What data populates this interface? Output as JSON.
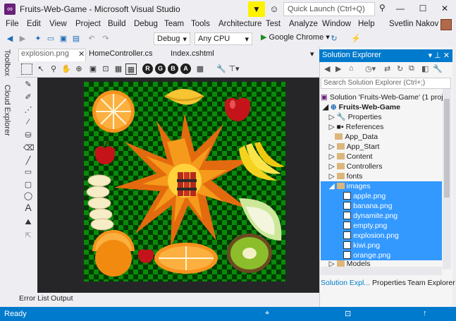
{
  "window": {
    "title": "Fruits-Web-Game - Microsoft Visual Studio",
    "quick_launch_placeholder": "Quick Launch (Ctrl+Q)"
  },
  "menu": {
    "items": [
      "File",
      "Edit",
      "View",
      "Project",
      "Build",
      "Debug",
      "Team",
      "Tools",
      "Architecture",
      "Test",
      "Analyze",
      "Window",
      "Help"
    ],
    "user": "Svetlin Nakov"
  },
  "toolbar": {
    "config": "Debug",
    "platform": "Any CPU",
    "run_target": "Google Chrome"
  },
  "left_strip": {
    "toolbox": "Toolbox",
    "cloud_explorer": "Cloud Explorer"
  },
  "doc_tabs": [
    {
      "label": "explosion.png",
      "active": true
    },
    {
      "label": "HomeController.cs",
      "active": false
    },
    {
      "label": "Index.cshtml",
      "active": false
    }
  ],
  "image_toolbar": {
    "channels": [
      "R",
      "G",
      "B",
      "A"
    ]
  },
  "image_editor_tools": [
    "pencil",
    "brush",
    "airbrush",
    "eyedropper",
    "fill",
    "eraser",
    "line",
    "rectangle",
    "rounded-rectangle",
    "ellipse",
    "text",
    "zoom",
    "pan"
  ],
  "text_tool_glyph": "A",
  "solution_explorer": {
    "title": "Solution Explorer",
    "search_placeholder": "Search Solution Explorer (Ctrl+;)",
    "tree": [
      {
        "label": "Solution 'Fruits-Web-Game' (1 proj",
        "kind": "solution",
        "level": 0
      },
      {
        "label": "Fruits-Web-Game",
        "kind": "project",
        "level": 1
      },
      {
        "label": "Properties",
        "kind": "properties",
        "level": 2
      },
      {
        "label": "References",
        "kind": "references",
        "level": 2
      },
      {
        "label": "App_Data",
        "kind": "folder",
        "level": 2
      },
      {
        "label": "App_Start",
        "kind": "folder",
        "level": 2
      },
      {
        "label": "Content",
        "kind": "folder",
        "level": 2
      },
      {
        "label": "Controllers",
        "kind": "folder",
        "level": 2
      },
      {
        "label": "fonts",
        "kind": "folder",
        "level": 2
      },
      {
        "label": "images",
        "kind": "folder-open",
        "level": 2
      },
      {
        "label": "apple.png",
        "kind": "image",
        "level": 3
      },
      {
        "label": "banana.png",
        "kind": "image",
        "level": 3
      },
      {
        "label": "dynamite.png",
        "kind": "image",
        "level": 3
      },
      {
        "label": "empty.png",
        "kind": "image",
        "level": 3
      },
      {
        "label": "explosion.png",
        "kind": "image",
        "level": 3
      },
      {
        "label": "kiwi.png",
        "kind": "image",
        "level": 3
      },
      {
        "label": "orange.png",
        "kind": "image",
        "level": 3
      },
      {
        "label": "Models",
        "kind": "folder",
        "level": 2
      }
    ],
    "tabs": [
      "Solution Expl...",
      "Properties",
      "Team Explorer"
    ]
  },
  "bottom_tabs": [
    "Error List",
    "Output"
  ],
  "status": {
    "text": "Ready"
  },
  "colors": {
    "accent": "#007acc",
    "selection": "#3399ff",
    "notification": "#fff200"
  }
}
